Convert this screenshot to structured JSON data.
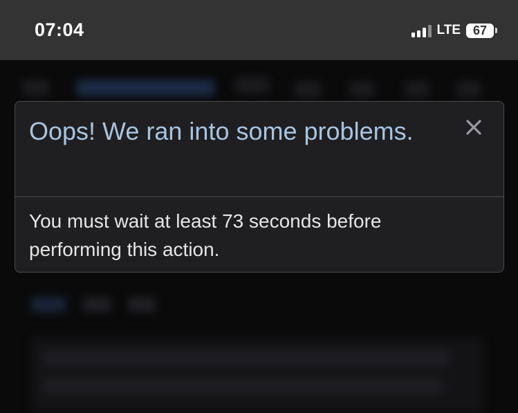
{
  "status_bar": {
    "time": "07:04",
    "network": "LTE",
    "battery": "67"
  },
  "modal": {
    "title": "Oops! We ran into some problems.",
    "message": "You must wait at least 73 seconds before performing this action.",
    "close_icon": "close-icon"
  },
  "colors": {
    "title": "#a8c4e0",
    "modal_bg": "#1f1f21",
    "page_bg": "#0a0a0b",
    "status_bar_bg": "#333333"
  }
}
